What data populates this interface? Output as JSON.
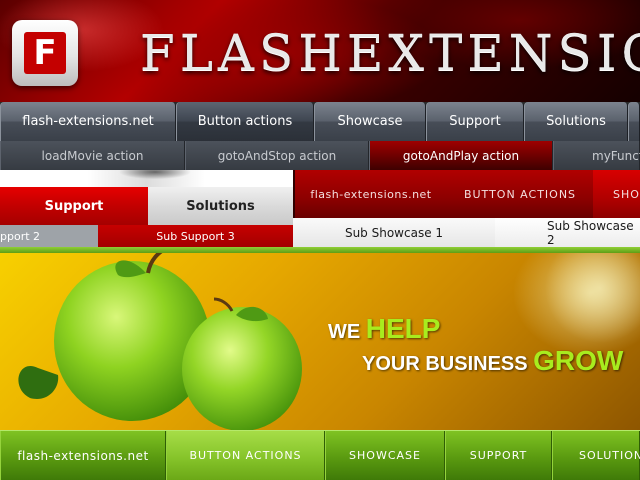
{
  "header": {
    "logo_glyph": "F",
    "brand": "FLASHEXTENSIC"
  },
  "gray_menu": {
    "items": [
      {
        "label": "flash-extensions.net",
        "active": false
      },
      {
        "label": "Button actions",
        "active": true
      },
      {
        "label": "Showcase",
        "active": false
      },
      {
        "label": "Support",
        "active": false
      },
      {
        "label": "Solutions",
        "active": false
      },
      {
        "label": "",
        "active": false
      }
    ],
    "submenu": [
      {
        "label": "loadMovie action",
        "active": false
      },
      {
        "label": "gotoAndStop action",
        "active": false
      },
      {
        "label": "gotoAndPlay action",
        "active": true
      },
      {
        "label": "myFuncti",
        "active": false
      }
    ]
  },
  "red_light_menu": {
    "items": [
      {
        "label": "Support",
        "active": true
      },
      {
        "label": "Solutions",
        "active": false
      }
    ],
    "submenu": [
      {
        "label": "pport 2"
      },
      {
        "label": "Sub Support 3"
      }
    ]
  },
  "dark_red_menu": {
    "items": [
      {
        "label": "flash-extensions.net",
        "active": false
      },
      {
        "label": "BUTTON ACTIONS",
        "active": false
      },
      {
        "label": "SHOW",
        "active": true
      }
    ],
    "submenu": [
      {
        "label": "Sub Showcase 1"
      },
      {
        "label": "Sub Showcase 2"
      }
    ]
  },
  "apple_banner": {
    "slogan_we": "WE",
    "slogan_help": "HELP",
    "slogan_your_business": "YOUR BUSINESS",
    "slogan_grow": "GROW",
    "colors": {
      "highlight": "#a8ec1e",
      "apple": "#7cc21a"
    }
  },
  "green_menu": {
    "items": [
      {
        "label": "flash-extensions.net",
        "active": false
      },
      {
        "label": "BUTTON ACTIONS",
        "active": true
      },
      {
        "label": "SHOWCASE",
        "active": false
      },
      {
        "label": "SUPPORT",
        "active": false
      },
      {
        "label": "SOLUTIONS",
        "active": false
      }
    ]
  }
}
